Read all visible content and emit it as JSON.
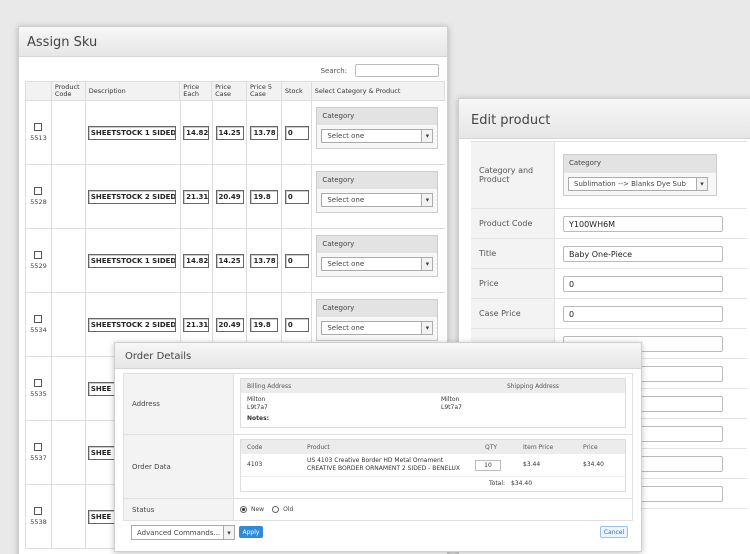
{
  "assign": {
    "title": "Assign Sku",
    "search_label": "Search:",
    "headers": [
      "",
      "Product Code",
      "Description",
      "Price Each",
      "Price Case",
      "Price 5 Case",
      "Stock",
      "Select Category & Product"
    ],
    "category_label": "Category",
    "select_placeholder": "Select one",
    "rows": [
      {
        "sku": "5513",
        "desc": "SHEETSTOCK 1 SIDED",
        "each": "14.82",
        "case": "14.25",
        "case5": "13.78",
        "stock": "0"
      },
      {
        "sku": "5528",
        "desc": "SHEETSTOCK 2 SIDED",
        "each": "21.31",
        "case": "20.49",
        "case5": "19.8",
        "stock": "0"
      },
      {
        "sku": "5529",
        "desc": "SHEETSTOCK 1 SIDED",
        "each": "14.82",
        "case": "14.25",
        "case5": "13.78",
        "stock": "0"
      },
      {
        "sku": "5534",
        "desc": "SHEETSTOCK 2 SIDED",
        "each": "21.31",
        "case": "20.49",
        "case5": "19.8",
        "stock": "0"
      },
      {
        "sku": "5535",
        "desc": "SHEE",
        "each": "",
        "case": "",
        "case5": "",
        "stock": ""
      },
      {
        "sku": "5537",
        "desc": "SHEE",
        "each": "",
        "case": "",
        "case5": "",
        "stock": ""
      },
      {
        "sku": "5538",
        "desc": "SHEE",
        "each": "",
        "case": "",
        "case5": "",
        "stock": ""
      }
    ]
  },
  "edit": {
    "title": "Edit product",
    "category_product_label": "Category and Product",
    "category_label": "Category",
    "category_value": "Sublimation --> Blanks Dye Sub",
    "product_code_label": "Product Code",
    "product_code": "Y100WH6M",
    "title_label": "Title",
    "title_value": "Baby One-Piece",
    "price_label": "Price",
    "price_value": "0",
    "case_price_label": "Case Price",
    "case_price_value": "0"
  },
  "order": {
    "title": "Order Details",
    "address_label": "Address",
    "billing_label": "Billing Address",
    "shipping_label": "Shipping Address",
    "billing_line1": "Milton",
    "billing_line2": "L9t7a7",
    "shipping_line1": "Milton",
    "shipping_line2": "L9t7a7",
    "notes_label": "Notes:",
    "order_data_label": "Order Data",
    "col_code": "Code",
    "col_product": "Product",
    "col_qty": "QTY",
    "col_item_price": "Item Price",
    "col_price": "Price",
    "item_code": "4103",
    "item_product_line1": "US 4103 Creative Border HD Metal Ornament",
    "item_product_line2": "CREATIVE BORDER ORNAMENT 2 SIDED - BENELUX",
    "item_qty": "10",
    "item_price": "$3.44",
    "item_total": "$34.40",
    "total_label": "Total:",
    "total_value": "$34.40",
    "status_label": "Status",
    "status_new": "New",
    "status_old": "Old",
    "advanced_commands": "Advanced Commands...",
    "apply": "Apply",
    "cancel": "Cancel"
  }
}
